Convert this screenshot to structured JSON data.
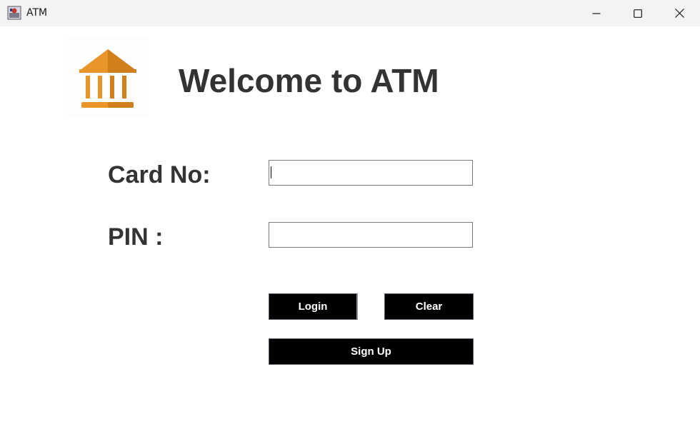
{
  "window": {
    "title": "ATM",
    "controls": {
      "minimize_icon": "minimize-icon",
      "maximize_icon": "maximize-icon",
      "close_icon": "close-icon"
    }
  },
  "header": {
    "logo_icon": "bank-icon",
    "heading": "Welcome to ATM"
  },
  "form": {
    "card_label": "Card No:",
    "card_value": "",
    "pin_label": "PIN :",
    "pin_value": ""
  },
  "buttons": {
    "login": "Login",
    "clear": "Clear",
    "signup": "Sign Up"
  },
  "colors": {
    "accent_orange": "#e8962a",
    "accent_orange_dark": "#d07f1c",
    "text_dark": "#333333",
    "button_bg": "#000000",
    "button_text": "#ffffff"
  }
}
